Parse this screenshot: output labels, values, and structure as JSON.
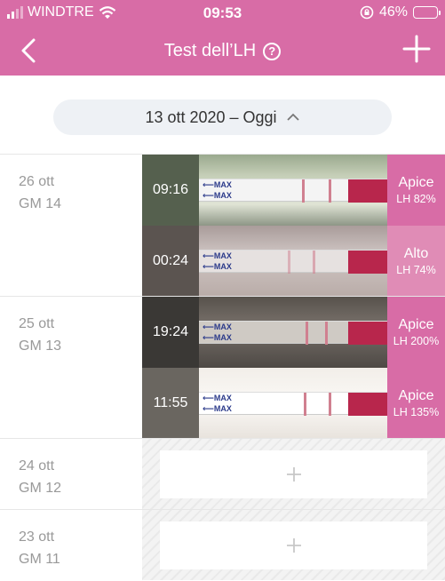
{
  "status": {
    "carrier": "WINDTRE",
    "time": "09:53",
    "battery": "46%"
  },
  "nav": {
    "title": "Test dell’LH",
    "help": "?"
  },
  "range": {
    "label": "13 ott 2020 – Oggi"
  },
  "days": [
    {
      "date": "26 ott",
      "cycle_day": "GM 14",
      "entries": [
        {
          "time": "09:16",
          "level": "Apice",
          "lh": "LH 82%"
        },
        {
          "time": "00:24",
          "level": "Alto",
          "lh": "LH 74%"
        }
      ]
    },
    {
      "date": "25 ott",
      "cycle_day": "GM 13",
      "entries": [
        {
          "time": "19:24",
          "level": "Apice",
          "lh": "LH 200%"
        },
        {
          "time": "11:55",
          "level": "Apice",
          "lh": "LH 135%"
        }
      ]
    },
    {
      "date": "24 ott",
      "cycle_day": "GM 12",
      "entries": []
    },
    {
      "date": "23 ott",
      "cycle_day": "GM 11",
      "entries": []
    }
  ],
  "photo_strip_text": "MAX",
  "colors": {
    "accent": "#d86ca6"
  }
}
